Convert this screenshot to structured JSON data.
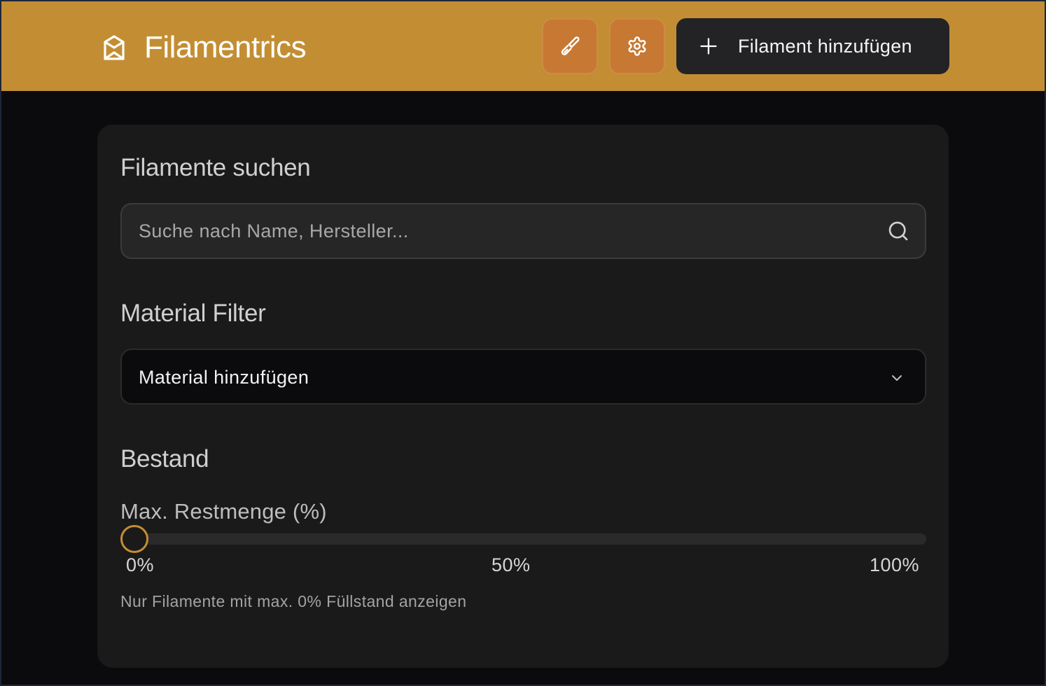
{
  "header": {
    "title": "Filamentrics",
    "logo_icon": "package-icon",
    "theme_button_icon": "paintbrush-icon",
    "settings_button_icon": "gear-icon",
    "add_button_label": "Filament hinzufügen",
    "accent_color": "#c38e33"
  },
  "search": {
    "title": "Filamente suchen",
    "placeholder": "Suche nach Name, Hersteller...",
    "value": ""
  },
  "material_filter": {
    "title": "Material Filter",
    "selected": "Material hinzufügen"
  },
  "stock": {
    "title": "Bestand",
    "slider_label": "Max. Restmenge (%)",
    "slider_value_percent": 0,
    "tick_min": "0%",
    "tick_mid": "50%",
    "tick_max": "100%",
    "hint": "Nur Filamente mit max. 0% Füllstand anzeigen"
  }
}
